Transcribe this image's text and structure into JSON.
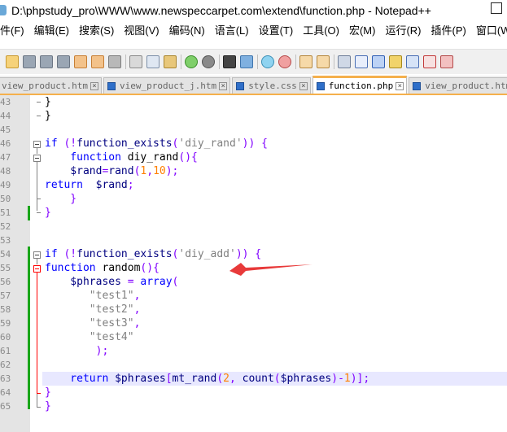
{
  "window": {
    "title": "D:\\phpstudy_pro\\WWW\\www.newspeccarpet.com\\extend\\function.php - Notepad++"
  },
  "menu": {
    "items": [
      "件(F)",
      "编辑(E)",
      "搜索(S)",
      "视图(V)",
      "编码(N)",
      "语言(L)",
      "设置(T)",
      "工具(O)",
      "宏(M)",
      "运行(R)",
      "插件(P)",
      "窗口(W)"
    ]
  },
  "tabs": [
    {
      "label": "view_product.htm",
      "active": false
    },
    {
      "label": "view_product_j.htm",
      "active": false
    },
    {
      "label": "style.css",
      "active": false
    },
    {
      "label": "function.php",
      "active": true
    },
    {
      "label": "view_product.htm",
      "active": false
    }
  ],
  "colors": {
    "accent": "#f5b04c",
    "annotation_arrow": "#e83a3a",
    "change_bar": "#1aa61a"
  },
  "annotation": {
    "type": "arrow",
    "points_to_line": "65"
  },
  "editor": {
    "lines": [
      {
        "num": "43",
        "code": "}",
        "tokens": [
          {
            "t": "}",
            "c": "txt"
          }
        ]
      },
      {
        "num": "44",
        "code": "}",
        "tokens": [
          {
            "t": "}",
            "c": "txt"
          }
        ]
      },
      {
        "num": "45",
        "code": "",
        "tokens": []
      },
      {
        "num": "46",
        "tokens": [
          {
            "t": "if ",
            "c": "kw"
          },
          {
            "t": "(!",
            "c": "op"
          },
          {
            "t": "function_exists",
            "c": "fn"
          },
          {
            "t": "(",
            "c": "op"
          },
          {
            "t": "'diy_rand'",
            "c": "str"
          },
          {
            "t": ")) {",
            "c": "op"
          }
        ]
      },
      {
        "num": "47",
        "tokens": [
          {
            "t": "    function ",
            "c": "kw"
          },
          {
            "t": "diy_rand",
            "c": "txt"
          },
          {
            "t": "(){",
            "c": "op"
          }
        ]
      },
      {
        "num": "48",
        "tokens": [
          {
            "t": "    $rand",
            "c": "var"
          },
          {
            "t": "=",
            "c": "op"
          },
          {
            "t": "rand",
            "c": "fn"
          },
          {
            "t": "(",
            "c": "op"
          },
          {
            "t": "1",
            "c": "num"
          },
          {
            "t": ",",
            "c": "op"
          },
          {
            "t": "10",
            "c": "num"
          },
          {
            "t": ");",
            "c": "op"
          }
        ]
      },
      {
        "num": "49",
        "tokens": [
          {
            "t": "return  ",
            "c": "kw"
          },
          {
            "t": "$rand",
            "c": "var"
          },
          {
            "t": ";",
            "c": "op"
          }
        ]
      },
      {
        "num": "50",
        "tokens": [
          {
            "t": "    }",
            "c": "op"
          }
        ]
      },
      {
        "num": "51",
        "tokens": [
          {
            "t": "}",
            "c": "op"
          }
        ]
      },
      {
        "num": "52",
        "tokens": []
      },
      {
        "num": "53",
        "tokens": []
      },
      {
        "num": "54",
        "tokens": [
          {
            "t": "if ",
            "c": "kw"
          },
          {
            "t": "(!",
            "c": "op"
          },
          {
            "t": "function_exists",
            "c": "fn"
          },
          {
            "t": "(",
            "c": "op"
          },
          {
            "t": "'diy_add'",
            "c": "str"
          },
          {
            "t": ")) {",
            "c": "op"
          }
        ]
      },
      {
        "num": "55",
        "tokens": [
          {
            "t": "function ",
            "c": "kw"
          },
          {
            "t": "random",
            "c": "txt"
          },
          {
            "t": "(){",
            "c": "op"
          }
        ]
      },
      {
        "num": "56",
        "tokens": [
          {
            "t": "    $phrases ",
            "c": "var"
          },
          {
            "t": "= ",
            "c": "op"
          },
          {
            "t": "array",
            "c": "kw"
          },
          {
            "t": "(",
            "c": "op"
          }
        ]
      },
      {
        "num": "57",
        "tokens": [
          {
            "t": "       \"test1\"",
            "c": "str"
          },
          {
            "t": ",",
            "c": "op"
          }
        ]
      },
      {
        "num": "58",
        "tokens": [
          {
            "t": "       \"test2\"",
            "c": "str"
          },
          {
            "t": ",",
            "c": "op"
          }
        ]
      },
      {
        "num": "59",
        "tokens": [
          {
            "t": "       \"test3\"",
            "c": "str"
          },
          {
            "t": ",",
            "c": "op"
          }
        ]
      },
      {
        "num": "60",
        "tokens": [
          {
            "t": "       \"test4\"",
            "c": "str"
          }
        ]
      },
      {
        "num": "61",
        "tokens": [
          {
            "t": "        );",
            "c": "op"
          }
        ]
      },
      {
        "num": "62",
        "tokens": []
      },
      {
        "num": "63",
        "tokens": [
          {
            "t": "    return ",
            "c": "kw"
          },
          {
            "t": "$phrases",
            "c": "var"
          },
          {
            "t": "[",
            "c": "op"
          },
          {
            "t": "mt_rand",
            "c": "fn"
          },
          {
            "t": "(",
            "c": "op"
          },
          {
            "t": "2",
            "c": "num"
          },
          {
            "t": ", ",
            "c": "op"
          },
          {
            "t": "count",
            "c": "fn"
          },
          {
            "t": "(",
            "c": "op"
          },
          {
            "t": "$phrases",
            "c": "var"
          },
          {
            "t": ")-",
            "c": "op"
          },
          {
            "t": "1",
            "c": "num"
          },
          {
            "t": ")];",
            "c": "op"
          }
        ]
      },
      {
        "num": "64",
        "tokens": [
          {
            "t": "}",
            "c": "op"
          }
        ]
      },
      {
        "num": "65",
        "tokens": [
          {
            "t": "}",
            "c": "op"
          }
        ]
      }
    ]
  }
}
